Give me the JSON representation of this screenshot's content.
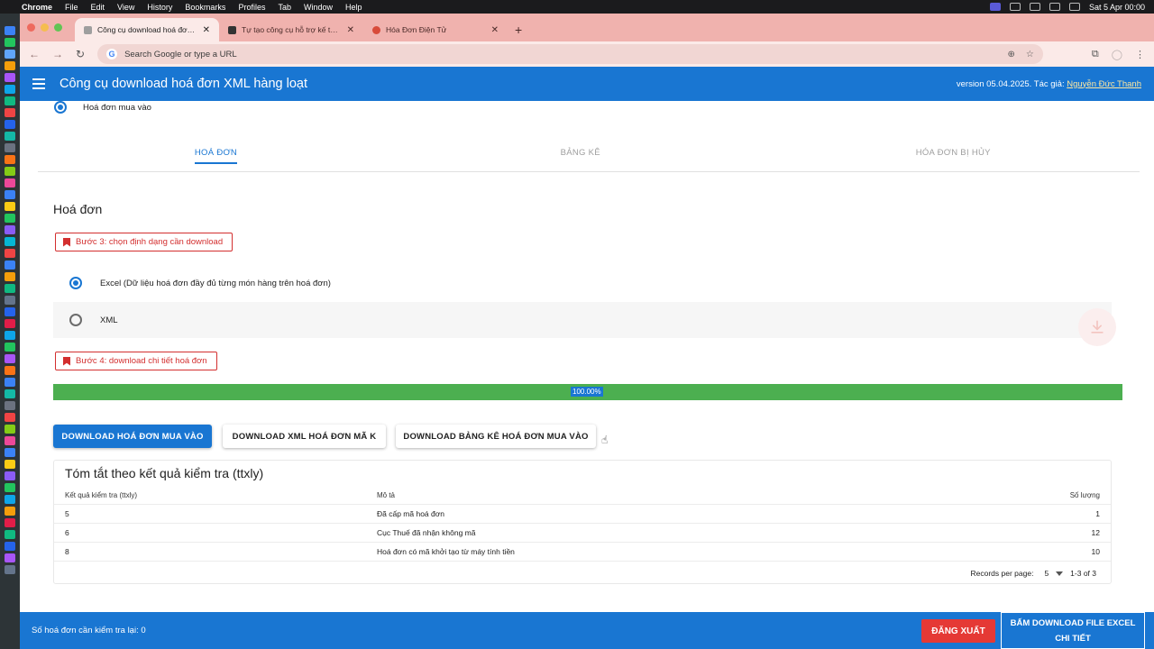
{
  "menubar": {
    "app": "Chrome",
    "items": [
      "File",
      "Edit",
      "View",
      "History",
      "Bookmarks",
      "Profiles",
      "Tab",
      "Window",
      "Help"
    ],
    "datetime": "Sat 5 Apr  00:00"
  },
  "browser": {
    "tabs": [
      {
        "title": "Công cụ download hoá đơn X",
        "active": true,
        "favicon_color": "#9e9e9e"
      },
      {
        "title": "Tự tạo công cụ hỗ trợ kế toán",
        "active": false,
        "favicon_color": "#333333"
      },
      {
        "title": "Hóa Đơn Điện Tử",
        "active": false,
        "favicon_color": "#d84b3a"
      }
    ],
    "address_placeholder": "Search Google or type a URL"
  },
  "app": {
    "title": "Công cụ download hoá đơn XML hàng loạt",
    "version_text": "version 05.04.2025. Tác giả:",
    "author": "Nguyễn Đức Thanh"
  },
  "invoice_type": {
    "label": "Hoá đơn mua vào",
    "selected": true
  },
  "section_tabs": [
    {
      "label": "HOÁ ĐƠN",
      "active": true
    },
    {
      "label": "BẢNG KÊ",
      "active": false
    },
    {
      "label": "HÓA ĐƠN BỊ HỦY",
      "active": false
    }
  ],
  "section_title": "Hoá đơn",
  "step3": {
    "label": "Bước 3: chọn định dạng cần download"
  },
  "format_options": [
    {
      "label": "Excel (Dữ liệu hoá đơn đầy đủ từng món hàng trên hoá đơn)",
      "selected": true
    },
    {
      "label": "XML",
      "selected": false
    }
  ],
  "step4": {
    "label": "Bước 4: download chi tiết hoá đơn"
  },
  "progress": {
    "value": 1.0,
    "label": "100.00%"
  },
  "buttons": {
    "download_invoices": "DOWNLOAD HOÁ ĐƠN MUA VÀO",
    "download_xml": "DOWNLOAD XML HOÁ ĐƠN MÃ K",
    "download_list": "DOWNLOAD BẢNG KÊ HOÁ ĐƠN MUA VÀO"
  },
  "summary": {
    "title": "Tóm tắt theo kết quả kiểm tra (ttxly)",
    "columns": [
      "Kết quả kiểm tra (ttxly)",
      "Mô tả",
      "Số lượng"
    ],
    "rows": [
      [
        "5",
        "Đã cấp mã hoá đơn",
        "1"
      ],
      [
        "6",
        "Cục Thuế đã nhận không mã",
        "12"
      ],
      [
        "8",
        "Hoá đơn có mã khởi tạo từ máy tính tiền",
        "10"
      ]
    ],
    "records_per_page_label": "Records per page:",
    "records_per_page": "5",
    "range": "1-3 of 3"
  },
  "footer": {
    "recheck_text": "Số hoá đơn cần kiểm tra lại: 0",
    "logout": "ĐĂNG XUẤT",
    "download_excel": "BẤM DOWNLOAD FILE EXCEL CHI TIẾT"
  },
  "colors": {
    "primary": "#1976d2",
    "success": "#4caf50",
    "danger": "#d32f2f",
    "tabstrip": "#f0b2ae"
  }
}
